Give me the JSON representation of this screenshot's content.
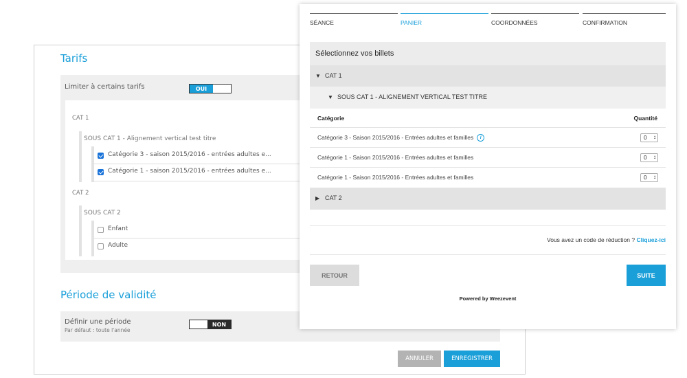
{
  "admin": {
    "tarifs_title": "Tarifs",
    "limit_label": "Limiter à certains tarifs",
    "limit_toggle": "OUI",
    "groups": [
      {
        "cat": "CAT 1",
        "subcat": "SOUS CAT 1 - Alignement vertical test titre",
        "items": [
          {
            "label": "Catégorie 3 - saison 2015/2016 - entrées adultes e...",
            "checked": true
          },
          {
            "label": "Catégorie 1 - saison 2015/2016 - entrées adultes e...",
            "checked": true
          }
        ]
      },
      {
        "cat": "CAT 2",
        "subcat": "SOUS CAT 2",
        "items": [
          {
            "label": "Enfant",
            "checked": false
          },
          {
            "label": "Adulte",
            "checked": false
          }
        ]
      }
    ],
    "validity_title": "Période de validité",
    "period_label": "Définir une période",
    "period_sub": "Par défaut : toute l'année",
    "period_toggle": "NON",
    "cancel": "ANNULER",
    "save": "ENREGISTRER"
  },
  "ticket": {
    "steps": [
      "SÉANCE",
      "PANIER",
      "COORDONNÉES",
      "CONFIRMATION"
    ],
    "active_step": "PANIER",
    "section_title": "Sélectionnez vos billets",
    "cat1": "CAT 1",
    "subcat1": "SOUS CAT 1 - ALIGNEMENT VERTICAL TEST TITRE",
    "col_category": "Catégorie",
    "col_quantity": "Quantité",
    "rows": [
      {
        "label": "Catégorie 3 - Saison 2015/2016 - Entrées adultes et familles",
        "qty": "0",
        "info": true
      },
      {
        "label": "Catégorie 1 - Saison 2015/2016 - Entrées adultes et familles",
        "qty": "0",
        "info": false
      },
      {
        "label": "Catégorie 1 - Saison 2015/2016 - Entrées adultes et familles",
        "qty": "0",
        "info": false
      }
    ],
    "cat2": "CAT 2",
    "discount_text": "Vous avez un code de réduction ?",
    "discount_link": "Cliquez-ici",
    "back": "RETOUR",
    "next": "SUITE",
    "powered": "Powered by Weezevent"
  },
  "colors": {
    "accent": "#1a9fd9",
    "dark": "#2a2a2a",
    "grey_button": "#b3b3b3"
  },
  "icons": {
    "collapse": "triangle-down-icon",
    "expand": "triangle-right-icon",
    "info": "info-icon"
  }
}
